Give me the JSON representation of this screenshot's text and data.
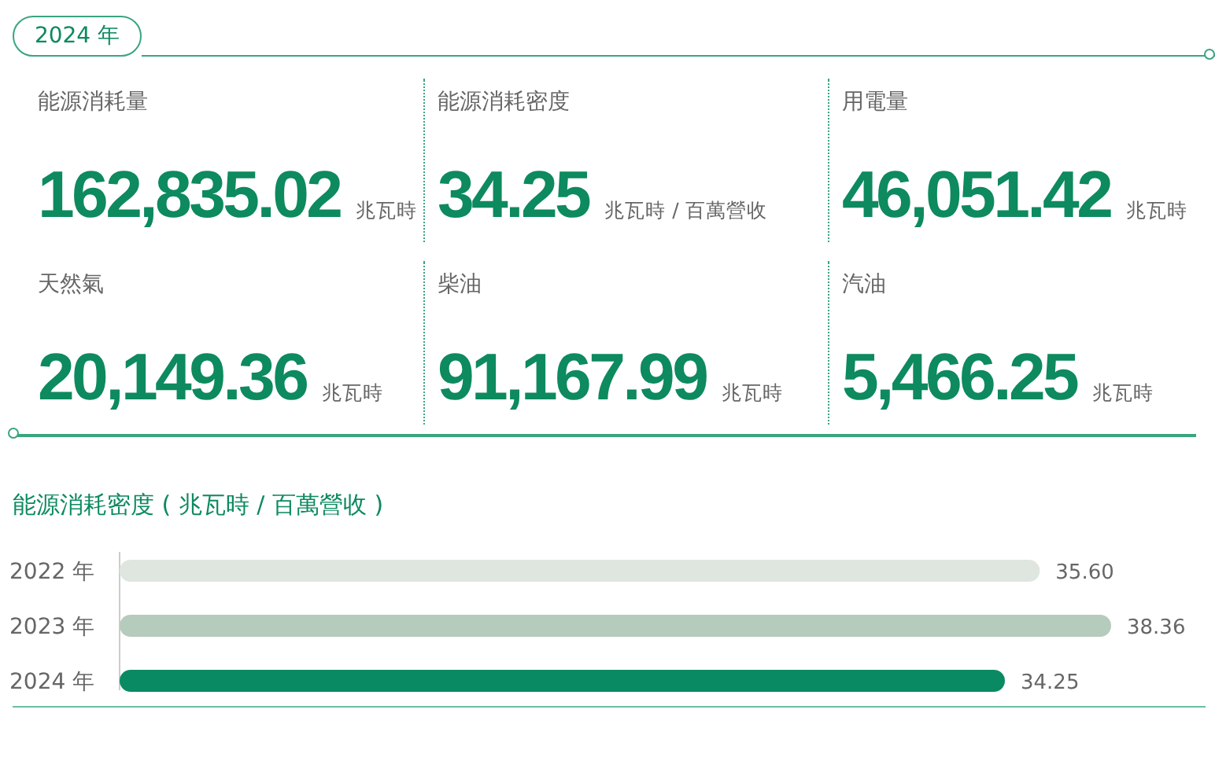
{
  "year_tab": {
    "label": "2024 年",
    "selected": true
  },
  "metrics": [
    {
      "label": "能源消耗量",
      "value": "162,835.02",
      "unit": "兆瓦時"
    },
    {
      "label": "能源消耗密度",
      "value": "34.25",
      "unit": "兆瓦時 / 百萬營收"
    },
    {
      "label": "用電量",
      "value": "46,051.42",
      "unit": "兆瓦時"
    },
    {
      "label": "天然氣",
      "value": "20,149.36",
      "unit": "兆瓦時"
    },
    {
      "label": "柴油",
      "value": "91,167.99",
      "unit": "兆瓦時"
    },
    {
      "label": "汽油",
      "value": "5,466.25",
      "unit": "兆瓦時"
    }
  ],
  "chart": {
    "chart_data": {
      "type": "bar",
      "orientation": "horizontal",
      "title": "能源消耗密度 ( 兆瓦時 / 百萬營收 )",
      "categories": [
        "2022 年",
        "2023 年",
        "2024 年"
      ],
      "values": [
        35.6,
        38.36,
        34.25
      ],
      "colors": [
        "#dfe6df",
        "#b5cbbb",
        "#0a8a62"
      ],
      "value_labels": [
        "35.60",
        "38.36",
        "34.25"
      ],
      "data_labels": true
    }
  }
}
